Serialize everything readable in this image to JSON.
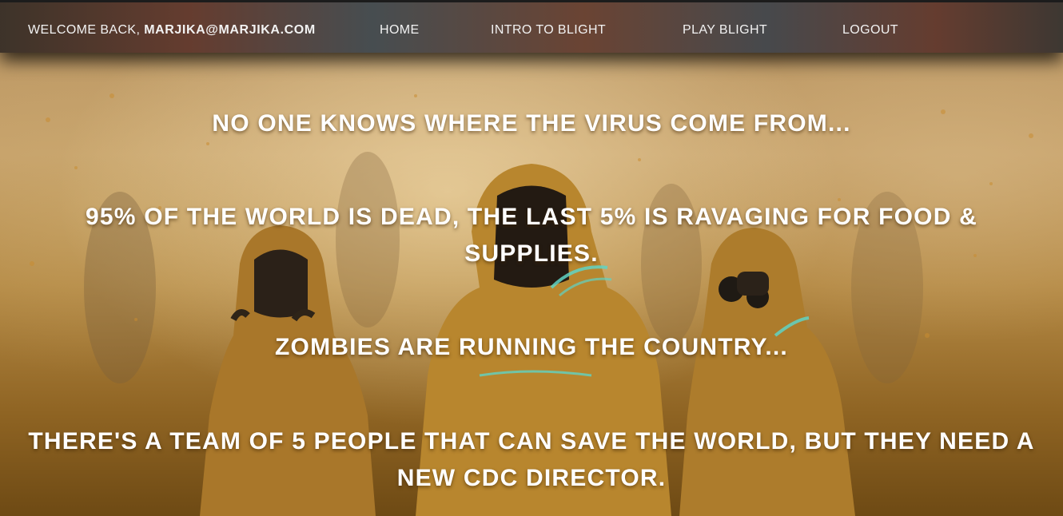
{
  "nav": {
    "welcome_prefix": "WELCOME BACK, ",
    "welcome_user": "MARJIKA@MARJIKA.COM",
    "home": "HOME",
    "intro": "INTRO TO BLIGHT",
    "play": "PLAY BLIGHT",
    "logout": "LOGOUT"
  },
  "story": {
    "line1": "NO ONE KNOWS WHERE THE VIRUS COME FROM...",
    "line2": "95% OF THE WORLD IS DEAD, THE LAST 5% IS RAVAGING FOR FOOD & SUPPLIES.",
    "line3": "ZOMBIES ARE RUNNING THE COUNTRY...",
    "line4": "THERE'S A TEAM OF 5 PEOPLE THAT CAN SAVE THE WORLD, BUT THEY NEED A NEW CDC DIRECTOR."
  },
  "colors": {
    "text": "#ffffff",
    "hazmat_suit": "#b8862e",
    "accent_teal": "#5fd3c4"
  }
}
